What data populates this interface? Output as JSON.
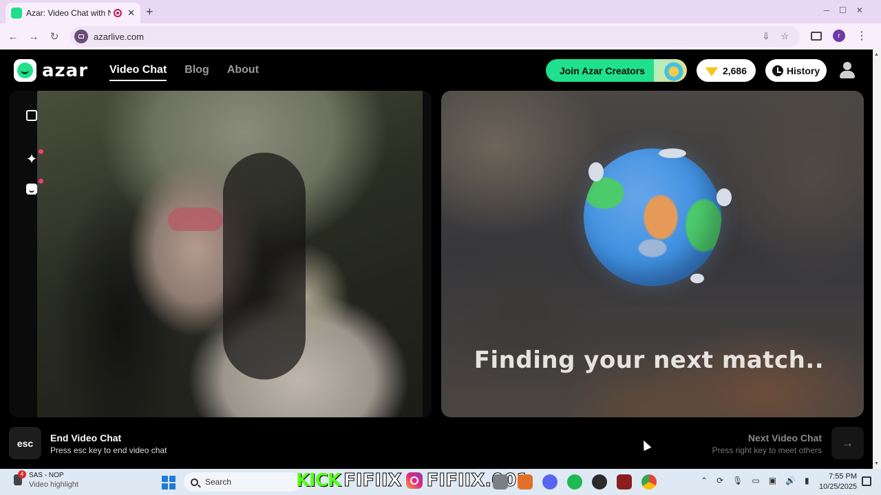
{
  "browser": {
    "tab_title": "Azar: Video Chat with New",
    "new_tab": "+",
    "tab_close": "✕",
    "url": "azarlive.com"
  },
  "header": {
    "logo_text": "azar",
    "nav": [
      {
        "label": "Video Chat",
        "active": true
      },
      {
        "label": "Blog",
        "active": false
      },
      {
        "label": "About",
        "active": false
      }
    ],
    "creators_button": "Join Azar Creators",
    "gems_count": "2,686",
    "history_button": "History"
  },
  "match_panel": {
    "status_text": "Finding your next match.."
  },
  "controls": {
    "end": {
      "key": "esc",
      "title": "End Video Chat",
      "subtitle": "Press esc key to end video chat"
    },
    "next": {
      "key_icon": "→",
      "title": "Next Video Chat",
      "subtitle": "Press right key to meet others"
    }
  },
  "taskbar": {
    "notification_count": "4",
    "status_title": "SAS - NOP",
    "status_subtitle": "Video highlight",
    "search_label": "Search",
    "overlay_kick": "KICK",
    "overlay_kick_name": "FIFIIX",
    "overlay_ig_name": "FIFIIX.001",
    "time": "7:55 PM",
    "date": "10/25/2025"
  },
  "colors": {
    "brand_green": "#1fe08c",
    "notification_dot": "#ff3d6e"
  }
}
